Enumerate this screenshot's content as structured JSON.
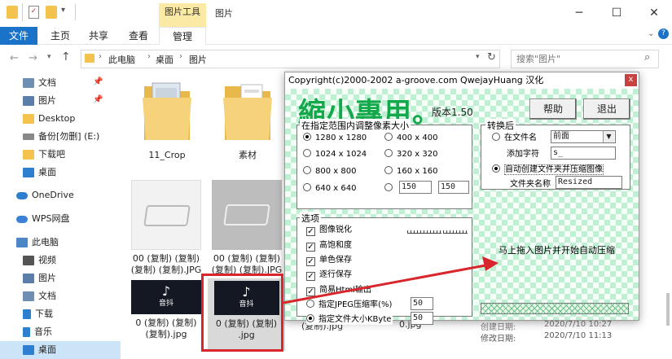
{
  "ribbon": {
    "tabs": [
      "文件",
      "主页",
      "共享",
      "查看",
      "管理"
    ],
    "context_label": "图片工具",
    "window_title": "图片"
  },
  "address": {
    "path": [
      "此电脑",
      "桌面",
      "图片"
    ],
    "search_placeholder": "搜索\"图片\""
  },
  "nav": [
    {
      "label": "文档",
      "icon": "document-icon",
      "pinned": true
    },
    {
      "label": "图片",
      "icon": "pictures-icon",
      "pinned": true
    },
    {
      "label": "Desktop",
      "icon": "folder-icon"
    },
    {
      "label": "备份[勿删] (E:)",
      "icon": "drive-icon"
    },
    {
      "label": "下载吧",
      "icon": "folder-icon"
    },
    {
      "label": "桌面",
      "icon": "desktop-icon"
    },
    {
      "label": "OneDrive",
      "icon": "cloud-icon"
    },
    {
      "label": "WPS网盘",
      "icon": "wps-cloud-icon"
    },
    {
      "label": "此电脑",
      "icon": "computer-icon"
    },
    {
      "label": "视频",
      "icon": "video-icon"
    },
    {
      "label": "图片",
      "icon": "pictures-icon"
    },
    {
      "label": "文档",
      "icon": "document-icon"
    },
    {
      "label": "下载",
      "icon": "download-icon"
    },
    {
      "label": "音乐",
      "icon": "music-icon"
    },
    {
      "label": "桌面",
      "icon": "desktop-icon",
      "selected": true
    }
  ],
  "files": {
    "folder1": "11_Crop",
    "folder2": "素材",
    "img1": "00 (复制) (复制) (复制) (复制).JPG",
    "img2": "00 (复制) (复制) (复制) (复制).JPG",
    "vid1_l1": "0 (复制) (复制)",
    "vid1_l2": "(复制).jpg",
    "vid2_l1": "0 (复制) (复制)",
    "vid2_l2": ".jpg",
    "vid3": "(复制).jpg",
    "vid4": "0.jpg",
    "tiktok_caption": "音抖"
  },
  "details": {
    "created_label": "创建日期:",
    "created": "2020/7/10 10:27",
    "modified_label": "修改日期:",
    "modified": "2020/7/10 11:13"
  },
  "dialog": {
    "title": "Copyright(c)2000-2002 a-groove.com QwejayHuang 汉化",
    "close": "x",
    "logo": "縮小專用。",
    "version": "版本1.50",
    "help": "帮助",
    "exit": "退出",
    "size_group": "在指定范围内调整像素大小",
    "sizes": [
      "1280 x 1280",
      "400 x 400",
      "1024 x 1024",
      "320 x 320",
      "800 x 800",
      "160 x 160",
      "640 x 640"
    ],
    "custom_w": "150",
    "custom_h": "150",
    "convert_group": "转换后",
    "in_filename": "在文件名",
    "position_value": "前面",
    "add_char_label": "添加字符",
    "add_char_value": "s_",
    "auto_folder": "自动创建文件夹并压缩图像",
    "folder_name_label": "文件夹名称",
    "folder_name_value": "Resized",
    "options_group": "选项",
    "options": [
      "图像锐化",
      "高饱和度",
      "单色保存",
      "逐行保存",
      "简易Html输出"
    ],
    "jpeg_ratio": "指定JPEG压缩率(%)",
    "jpeg_value": "50",
    "file_size": "指定文件大小KByte",
    "file_size_value": "50",
    "drop_hint": "马上拖入图片并开始自动压缩"
  },
  "colors": {
    "accent": "#1a73c8",
    "logo": "#13a84a",
    "highlight": "#d9262d"
  }
}
